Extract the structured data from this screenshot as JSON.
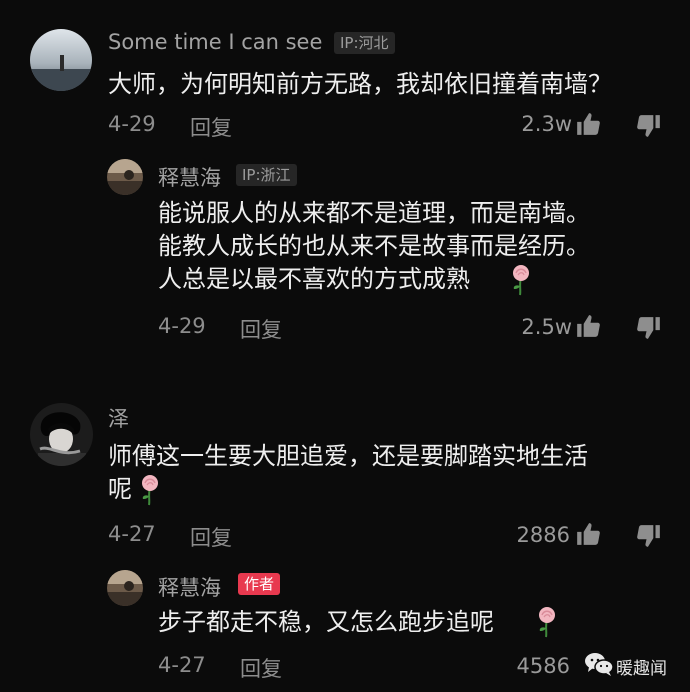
{
  "comments": [
    {
      "username": "Some time I can see",
      "ip": "IP:河北",
      "text": "大师，为何明知前方无路，我却依旧撞着南墙？",
      "date": "4-29",
      "reply_label": "回复",
      "likes": "2.3w",
      "replies": [
        {
          "username": "释慧海",
          "ip": "IP:浙江",
          "text": "能说服人的从来都不是道理，而是南墙。\n能教人成长的也从来不是故事而是经历。\n人总是以最不喜欢的方式成熟",
          "date": "4-29",
          "reply_label": "回复",
          "likes": "2.5w",
          "emoji": "rose-icon"
        }
      ]
    },
    {
      "username": "泽",
      "text": "师傅这一生要大胆追爱，还是要脚踏实地生活\n呢",
      "date": "4-27",
      "reply_label": "回复",
      "likes": "2886",
      "emoji": "rose-icon",
      "replies": [
        {
          "username": "释慧海",
          "author_badge": "作者",
          "text": "步子都走不稳，又怎么跑步追呢",
          "date": "4-27",
          "reply_label": "回复",
          "likes": "4586",
          "emoji": "rose-icon"
        }
      ]
    }
  ],
  "watermark": {
    "text": "暖趣闻",
    "icon": "wechat-icon"
  },
  "colors": {
    "background": "#0b0b0b",
    "author_badge": "#e8394f",
    "rose": "#f2b6c0"
  }
}
